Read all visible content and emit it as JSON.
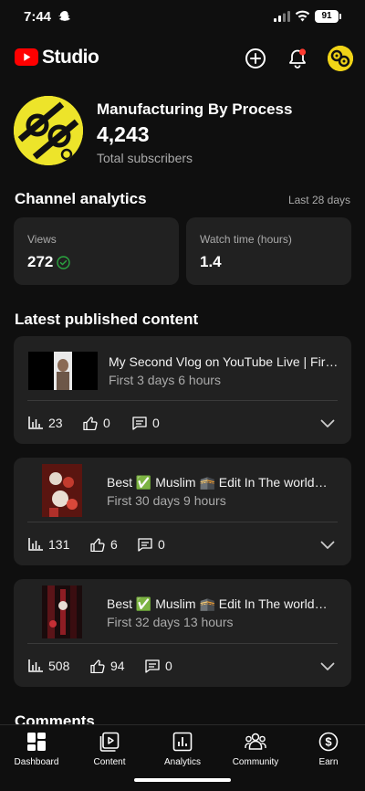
{
  "status_bar": {
    "time": "7:44",
    "battery": "91"
  },
  "header": {
    "studio_label": "Studio"
  },
  "channel": {
    "name": "Manufacturing By Process",
    "subscribers": "4,243",
    "subscribers_label": "Total subscribers"
  },
  "analytics": {
    "title": "Channel analytics",
    "period": "Last 28 days",
    "metrics": [
      {
        "label": "Views",
        "value": "272"
      },
      {
        "label": "Watch time (hours)",
        "value": "1.4"
      }
    ]
  },
  "latest": {
    "title": "Latest published content",
    "videos": [
      {
        "title": "My Second Vlog on YouTube Live | First...",
        "subtitle": "First 3 days 6 hours",
        "views": "23",
        "likes": "0",
        "comments": "0"
      },
      {
        "title": "Best ✅ Muslim 🕋 Edit In The world🌍 ...",
        "subtitle": "First 30 days 9 hours",
        "views": "131",
        "likes": "6",
        "comments": "0"
      },
      {
        "title": "Best ✅ Muslim 🕋 Edit In The world🌍 ...",
        "subtitle": "First 32 days 13 hours",
        "views": "508",
        "likes": "94",
        "comments": "0"
      }
    ]
  },
  "comments": {
    "title": "Comments"
  },
  "nav": {
    "items": [
      {
        "label": "Dashboard",
        "icon": "dashboard-icon"
      },
      {
        "label": "Content",
        "icon": "content-icon"
      },
      {
        "label": "Analytics",
        "icon": "analytics-icon"
      },
      {
        "label": "Community",
        "icon": "community-icon"
      },
      {
        "label": "Earn",
        "icon": "earn-icon"
      }
    ]
  },
  "colors": {
    "background": "#0f0f0f",
    "card": "#212121",
    "brand_red": "#ff0000",
    "check_green": "#2ba640",
    "notification_red": "#ff3b30"
  }
}
